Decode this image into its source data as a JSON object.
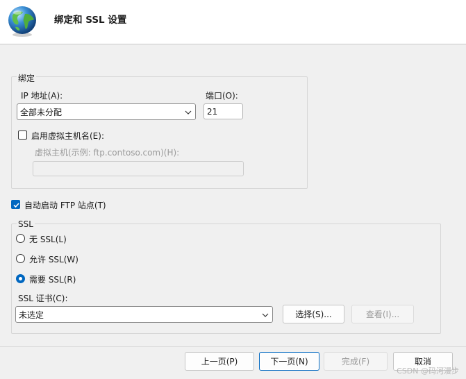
{
  "header": {
    "title": "绑定和 SSL 设置",
    "icon": "globe-icon"
  },
  "binding": {
    "legend": "绑定",
    "ip_label": "IP 地址(A):",
    "ip_value": "全部未分配",
    "port_label": "端口(O):",
    "port_value": "21",
    "virtual_host_checkbox": {
      "label": "启用虚拟主机名(E):",
      "checked": false
    },
    "virtual_host_label": "虚拟主机(示例: ftp.contoso.com)(H):",
    "virtual_host_value": ""
  },
  "autostart": {
    "label": "自动启动 FTP 站点(T)",
    "checked": true
  },
  "ssl": {
    "legend": "SSL",
    "options": [
      {
        "label": "无 SSL(L)",
        "checked": false
      },
      {
        "label": "允许 SSL(W)",
        "checked": false
      },
      {
        "label": "需要 SSL(R)",
        "checked": true
      }
    ],
    "cert_label": "SSL 证书(C):",
    "cert_value": "未选定",
    "select_button": "选择(S)...",
    "view_button": "查看(I)..."
  },
  "footer": {
    "prev": "上一页(P)",
    "next": "下一页(N)",
    "finish": "完成(F)",
    "cancel": "取消"
  },
  "watermark": "CSDN @码河漫步",
  "colors": {
    "accent": "#0067c0",
    "background": "#f0f0f0"
  }
}
